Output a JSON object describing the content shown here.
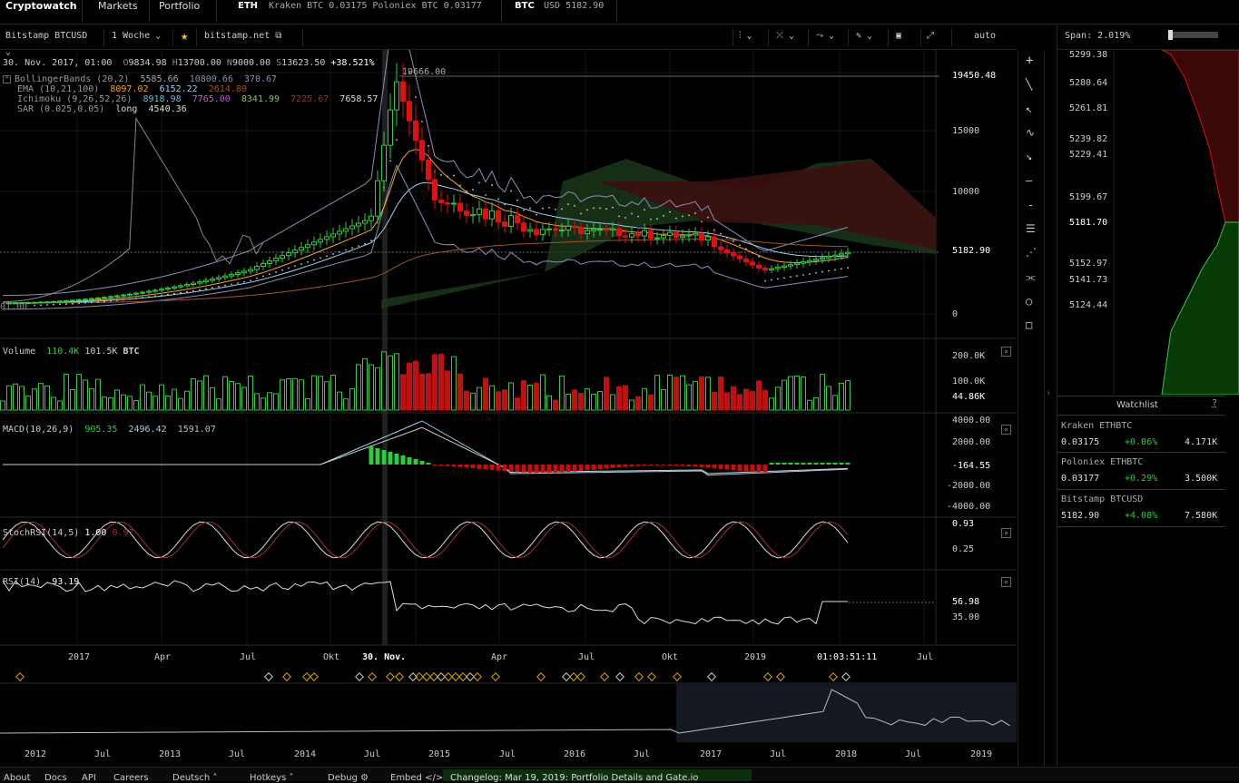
{
  "topbar": {
    "brand": "Cryptowatch",
    "markets": "Markets",
    "portfolio": "Portfolio",
    "eth_label": "ETH",
    "eth_quotes": "Kraken BTC 0.03175   Poloniex BTC 0.03177",
    "btc_label": "BTC",
    "btc_quote": "USD 5182.90"
  },
  "toolbar": {
    "market": "Bitstamp BTCUSD",
    "period": "1 Woche",
    "exchange_link": "bitstamp.net",
    "scale": "auto"
  },
  "ohlc": {
    "date": "30. Nov. 2017, 01:00",
    "o_label": "O",
    "o": "9834.98",
    "h_label": "H",
    "h": "13700.00",
    "n_label": "N",
    "n": "9000.00",
    "s_label": "S",
    "s": "13623.50",
    "change": "+38.521%"
  },
  "indicators": {
    "bb": {
      "name": "BollingerBands (20,2)",
      "v1": "5585.66",
      "v2": "10800.66",
      "v3": "370.67"
    },
    "ema": {
      "name": "EMA (10,21,100)",
      "v1": "8097.02",
      "v2": "6152.22",
      "v3": "2614.80"
    },
    "ichimoku": {
      "name": "Ichimoku (9,26,52,26)",
      "v1": "8918.98",
      "v2": "7765.00",
      "v3": "8341.99",
      "v4": "7225.67",
      "v5": "7658.57"
    },
    "sar": {
      "name": "SAR (0.025,0.05)",
      "v1": "long",
      "v2": "4540.36"
    }
  },
  "price_axis": {
    "ticks": [
      "19450.48",
      "15000",
      "10000",
      "5182.90",
      "0"
    ],
    "peak_label": "19666.00",
    "left_clip": "01.00"
  },
  "volume": {
    "name": "Volume",
    "v1": "110.4K",
    "v2": "101.5K",
    "unit": "BTC",
    "ticks": [
      "200.0K",
      "100.0K",
      "44.86K"
    ]
  },
  "macd": {
    "name": "MACD(10,26,9)",
    "v1": "905.35",
    "v2": "2496.42",
    "v3": "1591.07",
    "ticks": [
      "4000.00",
      "2000.00",
      "-164.55",
      "-2000.00",
      "-4000.00"
    ]
  },
  "stochrsi": {
    "name": "StochRSI(14,5)",
    "v1": "1.00",
    "v2": "0.97",
    "ticks": [
      "0.93",
      "0.25"
    ]
  },
  "rsi": {
    "name": "RSI(14)",
    "v1": "93.19",
    "ticks": [
      "56.98",
      "35.00"
    ]
  },
  "time_axis": [
    "2017",
    "Apr",
    "Jul",
    "Okt",
    "30. Nov.",
    "Apr",
    "Jul",
    "Okt",
    "2019",
    "01:03:51:11",
    "Jul"
  ],
  "nav_axis": [
    "2012",
    "Jul",
    "2013",
    "Jul",
    "2014",
    "Jul",
    "2015",
    "Jul",
    "2016",
    "Jul",
    "2017",
    "Jul",
    "2018",
    "Jul",
    "2019"
  ],
  "orderbook": {
    "span": "Span: 2.019%",
    "prices": [
      "5299.38",
      "5280.64",
      "5261.81",
      "5239.82",
      "5229.41",
      "5199.67",
      "5181.70",
      "5152.97",
      "5141.73",
      "5124.44"
    ]
  },
  "watchlist": {
    "title": "Watchlist",
    "help": "?",
    "items": [
      {
        "name": "Kraken ETHBTC",
        "price": "0.03175",
        "change": "+0.06%",
        "vol": "4.171K"
      },
      {
        "name": "Poloniex ETHBTC",
        "price": "0.03177",
        "change": "+0.29%",
        "vol": "3.500K"
      },
      {
        "name": "Bitstamp BTCUSD",
        "price": "5182.90",
        "change": "+4.08%",
        "vol": "7.580K"
      }
    ]
  },
  "footer": {
    "about": "About",
    "docs": "Docs",
    "api": "API",
    "careers": "Careers",
    "lang": "Deutsch",
    "hotkeys": "Hotkeys",
    "debug": "Debug",
    "embed": "Embed",
    "changelog": "Changelog: Mar 19, 2019: Portfolio Details and Gate.io"
  },
  "colors": {
    "up": "#2ecc40",
    "down": "#e01010",
    "accent": "#f5c518",
    "bg": "#000000"
  }
}
